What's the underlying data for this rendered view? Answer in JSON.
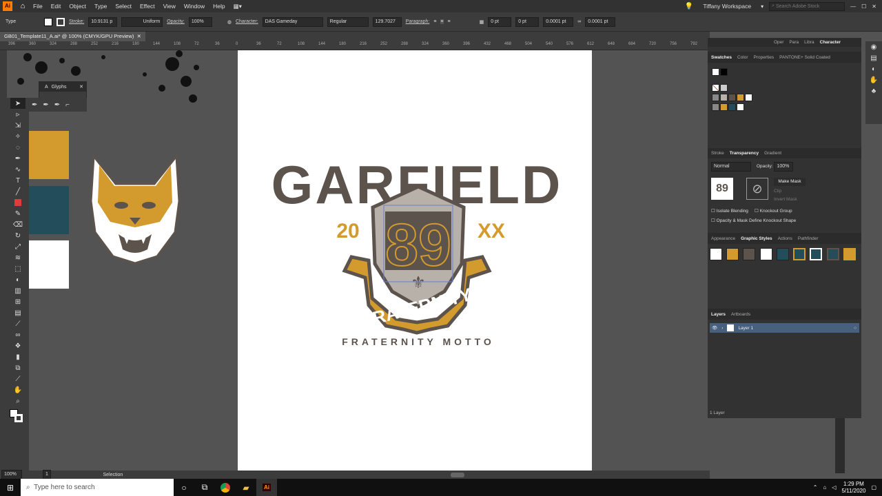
{
  "menubar": {
    "items": [
      "File",
      "Edit",
      "Object",
      "Type",
      "Select",
      "Effect",
      "View",
      "Window",
      "Help"
    ],
    "workspace": "Tiffany Workspace",
    "search_placeholder": "Search Adobe Stock"
  },
  "control": {
    "tool": "Type",
    "stroke_label": "Stroke:",
    "stroke_value": "10.9131 p",
    "stroke_profile": "Uniform",
    "opacity_label": "Opacity:",
    "opacity_value": "100%",
    "character_label": "Character:",
    "font": "DAS Gameday",
    "style": "Regular",
    "size": "129.7027",
    "paragraph_label": "Paragraph:",
    "x_value": "0 pt",
    "y_value": "0 pt",
    "w_value": "0.0001 pt",
    "h_value": "0.0001 pt"
  },
  "tab": {
    "title": "GB01_Template11_A.ai* @ 100% (CMYK/GPU Preview)"
  },
  "ruler": {
    "ticks": [
      "396",
      "360",
      "324",
      "288",
      "252",
      "216",
      "180",
      "144",
      "108",
      "72",
      "36",
      "0",
      "36",
      "72",
      "108",
      "144",
      "180",
      "216",
      "252",
      "288",
      "324",
      "360",
      "396",
      "432",
      "468",
      "504",
      "540",
      "576",
      "612",
      "648",
      "684",
      "720",
      "756",
      "792"
    ]
  },
  "glyphs": {
    "title": "Glyphs"
  },
  "artwork": {
    "top": "GARFIELD",
    "num": "89",
    "left": "20",
    "right": "XX",
    "banner": "FRATERNITY",
    "motto": "FRATERNITY MOTTO"
  },
  "panel": {
    "top_tabs": [
      "Oper",
      "Para",
      "Libra",
      "Character"
    ],
    "swatch_tabs": [
      "Swatches",
      "Color",
      "Properties",
      "PANTONE+ Solid Coated"
    ],
    "trans_tabs": [
      "Stroke",
      "Transparency",
      "Gradient"
    ],
    "blend": "Normal",
    "opacity_label": "Opacity:",
    "opacity_value": "100%",
    "thumb": "89",
    "make_mask": "Make Mask",
    "clip": "Clip",
    "invert": "Invert Mask",
    "isolate": "Isolate Blending",
    "knockout": "Knockout Group",
    "opacity_mask": "Opacity & Mask Define Knockout Shape",
    "app_tabs": [
      "Appearance",
      "Graphic Styles",
      "Actions",
      "Pathfinder"
    ],
    "layers_tabs": [
      "Layers",
      "Artboards"
    ],
    "layer_name": "Layer 1",
    "layer_count": "1 Layer"
  },
  "status": {
    "zoom": "100%",
    "page": "1",
    "tool": "Selection"
  },
  "taskbar": {
    "search": "Type here to search",
    "time": "1:29 PM",
    "date": "5/11/2020"
  },
  "colors": {
    "gold": "#d39a2d",
    "teal": "#244d5c",
    "brown": "#5d534d",
    "gray": "#b8b1aa"
  }
}
